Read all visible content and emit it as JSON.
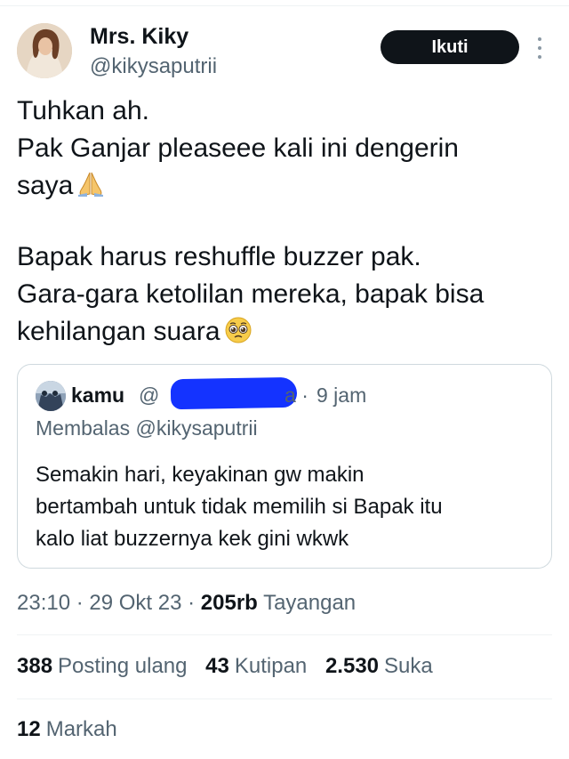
{
  "author": {
    "display_name": "Mrs. Kiky",
    "handle": "@kikysaputrii",
    "follow_label": "Ikuti"
  },
  "tweet": {
    "lines": [
      "Tuhkan ah.",
      "Pak Ganjar pleaseee kali ini dengerin",
      "saya"
    ],
    "lines2": [
      "Bapak harus reshuffle buzzer pak.",
      "Gara-gara ketolilan mereka, bapak bisa",
      "kehilangan suara"
    ],
    "emoji_1": "folded-hands-emoji",
    "emoji_2": "pleading-face-emoji"
  },
  "quote": {
    "name": "kamu",
    "handle_visible_start": "@",
    "handle_visible_end": "a",
    "separator": "·",
    "time": "9 jam",
    "reply_to": "Membalas @kikysaputrii",
    "lines": [
      "Semakin hari, keyakinan gw makin",
      "bertambah untuk tidak memilih si Bapak itu",
      "kalo liat buzzernya kek gini wkwk"
    ]
  },
  "meta": {
    "time": "23:10",
    "date": "29 Okt 23",
    "views_count": "205rb",
    "views_label": "Tayangan"
  },
  "stats": {
    "reposts_count": "388",
    "reposts_label": "Posting ulang",
    "quotes_count": "43",
    "quotes_label": "Kutipan",
    "likes_count": "2.530",
    "likes_label": "Suka",
    "bookmarks_count": "12",
    "bookmarks_label": "Markah"
  },
  "colors": {
    "text_primary": "#0f1419",
    "text_secondary": "#536471",
    "follow_button_bg": "#0f1419",
    "border": "#cfd9de",
    "redaction_scribble": "#1433ff"
  }
}
